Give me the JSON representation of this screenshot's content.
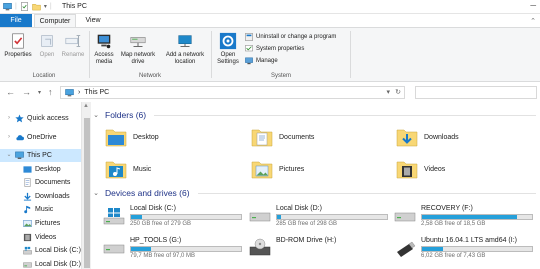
{
  "window": {
    "title": "This PC"
  },
  "ribbon_tabs": {
    "file": "File",
    "computer": "Computer",
    "view": "View"
  },
  "ribbon": {
    "location": {
      "label": "Location",
      "properties": "Properties",
      "open": "Open",
      "rename": "Rename"
    },
    "network": {
      "label": "Network",
      "access_media": "Access media",
      "map_network_drive": "Map network drive",
      "add_network_location": "Add a network location"
    },
    "system": {
      "label": "System",
      "open_settings": "Open Settings",
      "uninstall": "Uninstall or change a program",
      "system_properties": "System properties",
      "manage": "Manage"
    }
  },
  "address": {
    "path": "This PC",
    "separator": "›"
  },
  "nav": {
    "quick_access": "Quick access",
    "onedrive": "OneDrive",
    "this_pc": "This PC",
    "desktop": "Desktop",
    "documents": "Documents",
    "downloads": "Downloads",
    "music": "Music",
    "pictures": "Pictures",
    "videos": "Videos",
    "local_disk_c": "Local Disk (C:)",
    "local_disk_d": "Local Disk (D:)"
  },
  "content": {
    "folders_header": "Folders (6)",
    "folders": {
      "desktop": "Desktop",
      "documents": "Documents",
      "downloads": "Downloads",
      "music": "Music",
      "pictures": "Pictures",
      "videos": "Videos"
    },
    "drives_header": "Devices and drives (6)",
    "drives": {
      "c": {
        "name": "Local Disk (C:)",
        "space": "250 GB free of 279 GB",
        "used_fraction": 0.1
      },
      "d": {
        "name": "Local Disk (D:)",
        "space": "285 GB free of 298 GB",
        "used_fraction": 0.04
      },
      "f": {
        "name": "RECOVERY (F:)",
        "space": "2,58 GB free of 18,5 GB",
        "used_fraction": 0.86
      },
      "g": {
        "name": "HP_TOOLS (G:)",
        "space": "79,7 MB free of 97,0 MB",
        "used_fraction": 0.18
      },
      "h": {
        "name": "BD-ROM Drive (H:)",
        "space": "",
        "used_fraction": 0
      },
      "i": {
        "name": "Ubuntu 16.04.1 LTS amd64 (I:)",
        "space": "6,02 GB free of 7,43 GB",
        "used_fraction": 0.19
      }
    }
  },
  "colors": {
    "accent": "#1979ca",
    "selection": "#cce8ff",
    "drive_bar": "#26a0da",
    "section_text": "#1e3287",
    "folder": "#f8d775"
  }
}
